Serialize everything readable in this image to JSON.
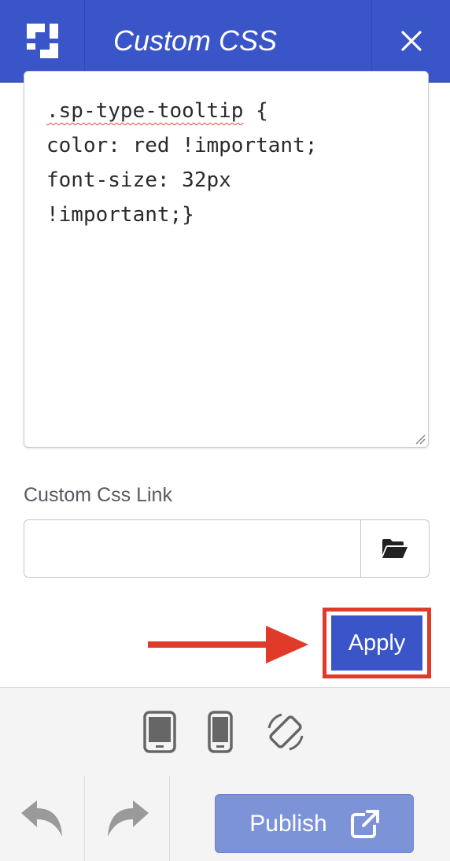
{
  "header": {
    "title": "Custom CSS",
    "logo_icon": "builder-logo-icon",
    "close_icon": "close-icon",
    "background_color": "#3a55c7"
  },
  "editor": {
    "code_lines": [
      ".sp-type-tooltip {",
      "color: red !important;",
      "font-size: 32px",
      "!important;}"
    ],
    "code_first_token": ".sp-type-tooltip",
    "code_first_rest": " {"
  },
  "custom_css_link": {
    "label": "Custom Css Link",
    "value": "",
    "placeholder": "",
    "browse_icon": "folder-open-icon"
  },
  "apply": {
    "label": "Apply",
    "highlight_color": "#e03a28"
  },
  "device_bar": {
    "icons": [
      "tablet-icon",
      "mobile-icon",
      "rotate-screen-icon"
    ]
  },
  "bottom_bar": {
    "undo_icon": "undo-icon",
    "redo_icon": "redo-icon",
    "publish_label": "Publish",
    "publish_icon": "external-link-icon"
  }
}
